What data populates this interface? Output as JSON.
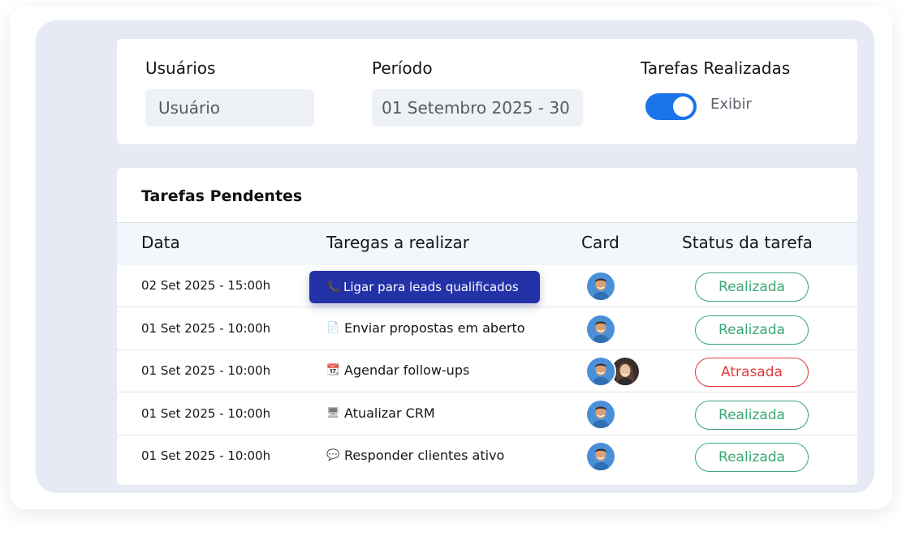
{
  "filters": {
    "users": {
      "label": "Usuários",
      "value": "Usuário"
    },
    "period": {
      "label": "Período",
      "value": "01 Setembro 2025 - 30"
    },
    "completed": {
      "label": "Tarefas Realizadas",
      "toggle_label": "Exibir",
      "enabled": true
    }
  },
  "table": {
    "title": "Tarefas Pendentes",
    "columns": [
      "Data",
      "Taregas a realizar",
      "Card",
      "Status da tarefa"
    ],
    "rows": [
      {
        "date": "02 Set 2025 - 15:00h",
        "icon": "phone-icon",
        "icon_glyph": "📞",
        "task": "Ligar para leads qualificados",
        "avatars": [
          "man"
        ],
        "status": "Realizada",
        "highlighted": true
      },
      {
        "date": "01 Set 2025 - 10:00h",
        "icon": "document-icon",
        "icon_glyph": "📄",
        "task": "Enviar propostas em aberto",
        "avatars": [
          "man"
        ],
        "status": "Realizada"
      },
      {
        "date": "01 Set 2025 - 10:00h",
        "icon": "calendar-icon",
        "icon_glyph": "📆",
        "task": "Agendar follow-ups",
        "avatars": [
          "man",
          "woman"
        ],
        "status": "Atrasada"
      },
      {
        "date": "01 Set 2025 - 10:00h",
        "icon": "computer-icon",
        "icon_glyph": "🖥",
        "task": "Atualizar CRM",
        "avatars": [
          "man"
        ],
        "status": "Realizada"
      },
      {
        "date": "01 Set 2025 - 10:00h",
        "icon": "speech-bubble-icon",
        "icon_glyph": "💬",
        "task": "Responder clientes ativo",
        "avatars": [
          "man"
        ],
        "status": "Realizada"
      }
    ]
  },
  "colors": {
    "toggle_on": "#1a73e8",
    "highlight": "#2432a8",
    "status_done": "#3aa874",
    "status_late": "#e03a3a"
  }
}
